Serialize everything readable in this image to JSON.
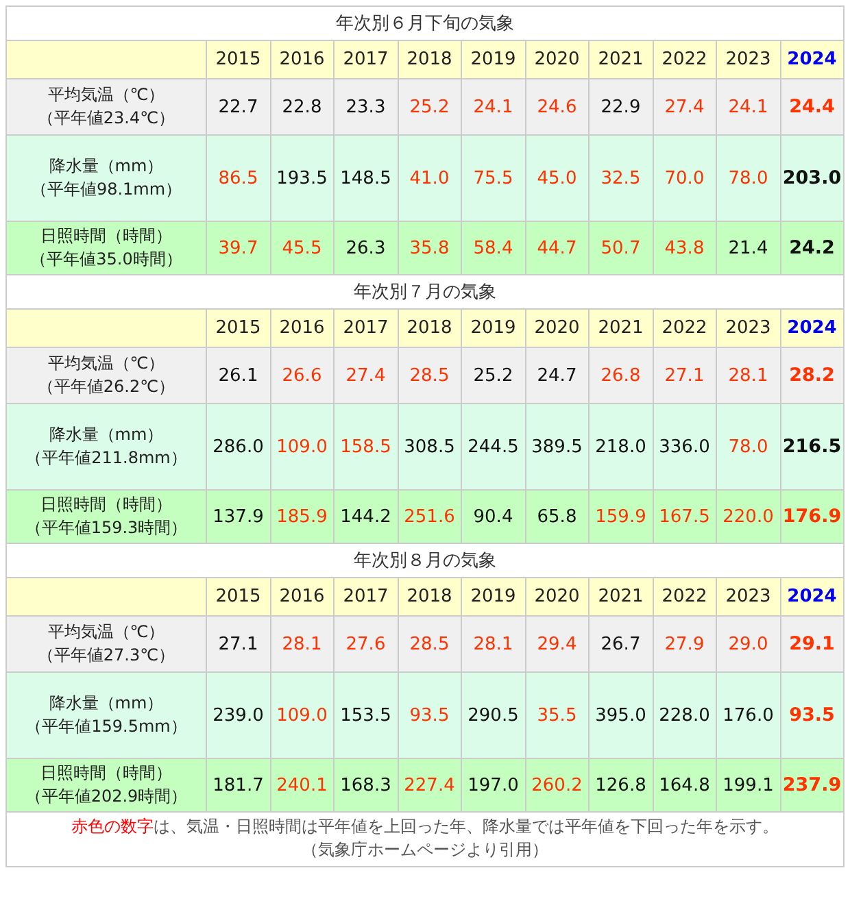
{
  "sections": [
    {
      "title": "年次別６月下旬の気象",
      "years": [
        {
          "label": "2015",
          "current": false
        },
        {
          "label": "2016",
          "current": false
        },
        {
          "label": "2017",
          "current": false
        },
        {
          "label": "2018",
          "current": false
        },
        {
          "label": "2019",
          "current": false
        },
        {
          "label": "2020",
          "current": false
        },
        {
          "label": "2021",
          "current": false
        },
        {
          "label": "2022",
          "current": false
        },
        {
          "label": "2023",
          "current": false
        },
        {
          "label": "2024",
          "current": true
        }
      ],
      "rows": [
        {
          "kind": "temperature",
          "label": "平均気温（℃）",
          "normal": "（平年値23.4℃）",
          "values": [
            {
              "text": "22.7",
              "red": false
            },
            {
              "text": "22.8",
              "red": false
            },
            {
              "text": "23.3",
              "red": false
            },
            {
              "text": "25.2",
              "red": true
            },
            {
              "text": "24.1",
              "red": true
            },
            {
              "text": "24.6",
              "red": true
            },
            {
              "text": "22.9",
              "red": false
            },
            {
              "text": "27.4",
              "red": true
            },
            {
              "text": "24.1",
              "red": true
            },
            {
              "text": "24.4",
              "red": true
            }
          ]
        },
        {
          "kind": "rain",
          "label": "降水量（mm）",
          "normal": "（平年値98.1mm）",
          "values": [
            {
              "text": "86.5",
              "red": true
            },
            {
              "text": "193.5",
              "red": false
            },
            {
              "text": "148.5",
              "red": false
            },
            {
              "text": "41.0",
              "red": true
            },
            {
              "text": "75.5",
              "red": true
            },
            {
              "text": "45.0",
              "red": true
            },
            {
              "text": "32.5",
              "red": true
            },
            {
              "text": "70.0",
              "red": true
            },
            {
              "text": "78.0",
              "red": true
            },
            {
              "text": "203.0",
              "red": false
            }
          ]
        },
        {
          "kind": "sunshine",
          "label": "日照時間（時間）",
          "normal": "（平年値35.0時間）",
          "values": [
            {
              "text": "39.7",
              "red": true
            },
            {
              "text": "45.5",
              "red": true
            },
            {
              "text": "26.3",
              "red": false
            },
            {
              "text": "35.8",
              "red": true
            },
            {
              "text": "58.4",
              "red": true
            },
            {
              "text": "44.7",
              "red": true
            },
            {
              "text": "50.7",
              "red": true
            },
            {
              "text": "43.8",
              "red": true
            },
            {
              "text": "21.4",
              "red": false
            },
            {
              "text": "24.2",
              "red": false
            }
          ]
        }
      ]
    },
    {
      "title": "年次別７月の気象",
      "years": [
        {
          "label": "2015",
          "current": false
        },
        {
          "label": "2016",
          "current": false
        },
        {
          "label": "2017",
          "current": false
        },
        {
          "label": "2018",
          "current": false
        },
        {
          "label": "2019",
          "current": false
        },
        {
          "label": "2020",
          "current": false
        },
        {
          "label": "2021",
          "current": false
        },
        {
          "label": "2022",
          "current": false
        },
        {
          "label": "2023",
          "current": false
        },
        {
          "label": "2024",
          "current": true
        }
      ],
      "rows": [
        {
          "kind": "temperature",
          "label": "平均気温（℃）",
          "normal": "（平年値26.2℃）",
          "values": [
            {
              "text": "26.1",
              "red": false
            },
            {
              "text": "26.6",
              "red": true
            },
            {
              "text": "27.4",
              "red": true
            },
            {
              "text": "28.5",
              "red": true
            },
            {
              "text": "25.2",
              "red": false
            },
            {
              "text": "24.7",
              "red": false
            },
            {
              "text": "26.8",
              "red": true
            },
            {
              "text": "27.1",
              "red": true
            },
            {
              "text": "28.1",
              "red": true
            },
            {
              "text": "28.2",
              "red": true
            }
          ]
        },
        {
          "kind": "rain",
          "label": "降水量（mm）",
          "normal": "（平年値211.8mm）",
          "values": [
            {
              "text": "286.0",
              "red": false
            },
            {
              "text": "109.0",
              "red": true
            },
            {
              "text": "158.5",
              "red": true
            },
            {
              "text": "308.5",
              "red": false
            },
            {
              "text": "244.5",
              "red": false
            },
            {
              "text": "389.5",
              "red": false
            },
            {
              "text": "218.0",
              "red": false
            },
            {
              "text": "336.0",
              "red": false
            },
            {
              "text": "78.0",
              "red": true
            },
            {
              "text": "216.5",
              "red": false
            }
          ]
        },
        {
          "kind": "sunshine",
          "label": "日照時間（時間）",
          "normal": "（平年値159.3時間）",
          "values": [
            {
              "text": "137.9",
              "red": false
            },
            {
              "text": "185.9",
              "red": true
            },
            {
              "text": "144.2",
              "red": false
            },
            {
              "text": "251.6",
              "red": true
            },
            {
              "text": "90.4",
              "red": false
            },
            {
              "text": "65.8",
              "red": false
            },
            {
              "text": "159.9",
              "red": true
            },
            {
              "text": "167.5",
              "red": true
            },
            {
              "text": "220.0",
              "red": true
            },
            {
              "text": "176.9",
              "red": true
            }
          ]
        }
      ]
    },
    {
      "title": "年次別８月の気象",
      "years": [
        {
          "label": "2015",
          "current": false
        },
        {
          "label": "2016",
          "current": false
        },
        {
          "label": "2017",
          "current": false
        },
        {
          "label": "2018",
          "current": false
        },
        {
          "label": "2019",
          "current": false
        },
        {
          "label": "2020",
          "current": false
        },
        {
          "label": "2021",
          "current": false
        },
        {
          "label": "2022",
          "current": false
        },
        {
          "label": "2023",
          "current": false
        },
        {
          "label": "2024",
          "current": true
        }
      ],
      "rows": [
        {
          "kind": "temperature",
          "label": "平均気温（℃）",
          "normal": "（平年値27.3℃）",
          "values": [
            {
              "text": "27.1",
              "red": false
            },
            {
              "text": "28.1",
              "red": true
            },
            {
              "text": "27.6",
              "red": true
            },
            {
              "text": "28.5",
              "red": true
            },
            {
              "text": "28.1",
              "red": true
            },
            {
              "text": "29.4",
              "red": true
            },
            {
              "text": "26.7",
              "red": false
            },
            {
              "text": "27.9",
              "red": true
            },
            {
              "text": "29.0",
              "red": true
            },
            {
              "text": "29.1",
              "red": true
            }
          ]
        },
        {
          "kind": "rain",
          "label": "降水量（mm）",
          "normal": "（平年値159.5mm）",
          "values": [
            {
              "text": "239.0",
              "red": false
            },
            {
              "text": "109.0",
              "red": true
            },
            {
              "text": "153.5",
              "red": false
            },
            {
              "text": "93.5",
              "red": true
            },
            {
              "text": "290.5",
              "red": false
            },
            {
              "text": "35.5",
              "red": true
            },
            {
              "text": "395.0",
              "red": false
            },
            {
              "text": "228.0",
              "red": false
            },
            {
              "text": "176.0",
              "red": false
            },
            {
              "text": "93.5",
              "red": true
            }
          ]
        },
        {
          "kind": "sunshine",
          "label": "日照時間（時間）",
          "normal": "（平年値202.9時間）",
          "values": [
            {
              "text": "181.7",
              "red": false
            },
            {
              "text": "240.1",
              "red": true
            },
            {
              "text": "168.3",
              "red": false
            },
            {
              "text": "227.4",
              "red": true
            },
            {
              "text": "197.0",
              "red": false
            },
            {
              "text": "260.2",
              "red": true
            },
            {
              "text": "126.8",
              "red": false
            },
            {
              "text": "164.8",
              "red": false
            },
            {
              "text": "199.1",
              "red": false
            },
            {
              "text": "237.9",
              "red": true
            }
          ]
        }
      ]
    }
  ],
  "footnote": {
    "highlight": "赤色の数字",
    "text": "は、気温・日照時間は平年値を上回った年、降水量では平年値を下回った年を示す。"
  },
  "source": "（気象庁ホームページより引用）"
}
